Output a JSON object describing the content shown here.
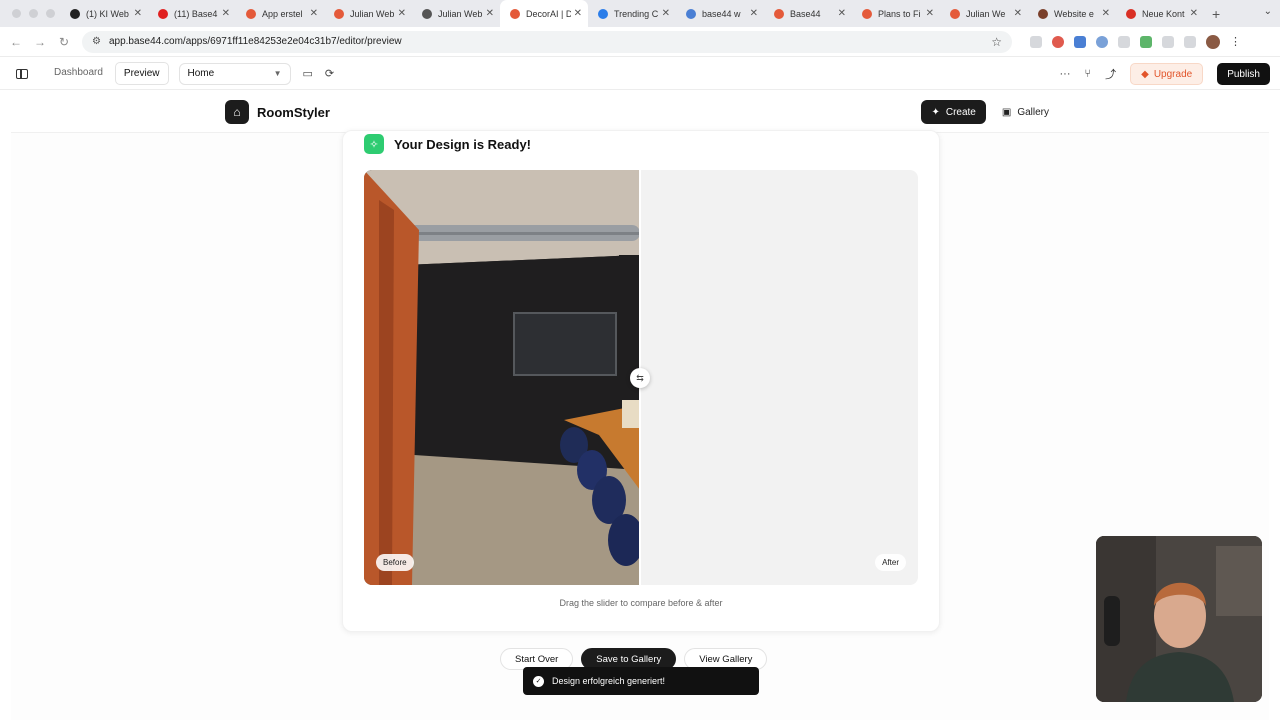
{
  "browser": {
    "tabs": [
      {
        "label": "(1) KI Web",
        "color": "#222222"
      },
      {
        "label": "(11) Base4",
        "color": "#e02020"
      },
      {
        "label": "App erstel",
        "color": "#e45a3a"
      },
      {
        "label": "Julian Web",
        "color": "#e45a3a"
      },
      {
        "label": "Julian Web",
        "color": "#555555"
      },
      {
        "label": "DecorAI | D",
        "color": "#e45a3a",
        "active": true
      },
      {
        "label": "Trending C",
        "color": "#2b7de9"
      },
      {
        "label": "base44 w",
        "color": "#4a7fd4"
      },
      {
        "label": "Base44",
        "color": "#e45a3a"
      },
      {
        "label": "Plans to Fi",
        "color": "#e45a3a"
      },
      {
        "label": "Julian We",
        "color": "#e45a3a"
      },
      {
        "label": "Website e",
        "color": "#7a3f2a"
      },
      {
        "label": "Neue Kont",
        "color": "#d93025"
      }
    ],
    "new_tab": "+",
    "url": "app.base44.com/apps/6971ff11e84253e2e04c31b7/editor/preview"
  },
  "editor": {
    "mode_dashboard": "Dashboard",
    "mode_preview": "Preview",
    "page_select": "Home",
    "upgrade_label": "Upgrade",
    "publish_label": "Publish"
  },
  "app": {
    "brand": "RoomStyler",
    "nav_create": "Create",
    "nav_gallery": "Gallery",
    "ready_title": "Your Design is Ready!",
    "tag_before": "Before",
    "tag_after": "After",
    "slider_position": 0.5,
    "hint": "Drag the slider to compare before & after",
    "btn_start_over": "Start Over",
    "btn_save": "Save to Gallery",
    "btn_view_gallery": "View Gallery",
    "toast": "Design erfolgreich generiert!"
  }
}
